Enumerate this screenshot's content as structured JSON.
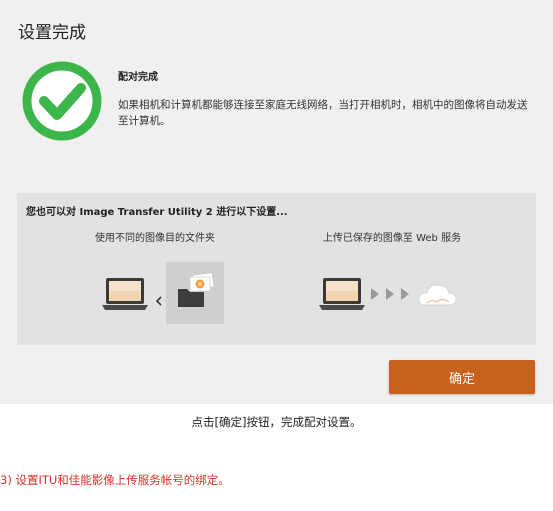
{
  "dialog": {
    "title": "设置完成",
    "message": {
      "heading": "配对完成",
      "body": "如果相机和计算机都能够连接至家庭无线网络，当打开相机时，相机中的图像将自动发送至计算机。"
    },
    "features": {
      "intro": "您也可以对 Image Transfer Utility 2 进行以下设置...",
      "items": [
        {
          "label": "使用不同的图像目的文件夹",
          "icon": "laptop-to-folder-illustration"
        },
        {
          "label": "上传已保存的图像至 Web 服务",
          "icon": "laptop-to-cloud-illustration"
        }
      ]
    },
    "ok_label": "确定",
    "accent_color": "#c8601e",
    "success_color": "#3cb54a"
  },
  "caption": "点击[确定]按钮，完成配对设置。",
  "step_note": "3) 设置ITU和佳能影像上传服务帐号的绑定。",
  "step_note_color": "#d9302a"
}
